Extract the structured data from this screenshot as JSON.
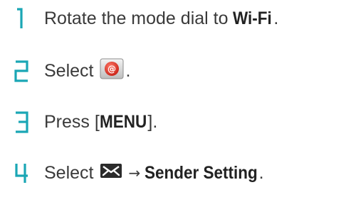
{
  "accent_color": "#1aa6b5",
  "steps": [
    {
      "number": "1",
      "text_before": "Rotate the mode dial to ",
      "emphasis": "Wi-Fi",
      "text_after": "."
    },
    {
      "number": "2",
      "text_before": "Select ",
      "icon": "email-app-icon",
      "text_after": "."
    },
    {
      "number": "3",
      "text_before": "Press [",
      "emphasis": "MENU",
      "text_after": "]."
    },
    {
      "number": "4",
      "text_before": "Select ",
      "icon": "envelope-menu-icon",
      "arrow": "→",
      "emphasis": "Sender Setting",
      "text_after": "."
    }
  ]
}
